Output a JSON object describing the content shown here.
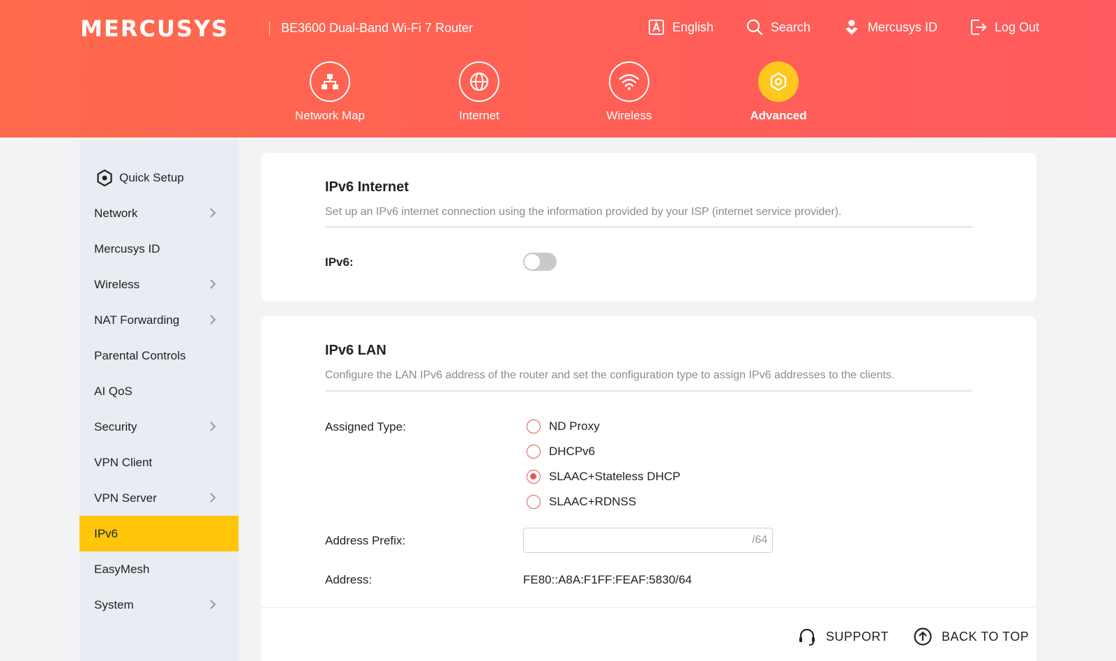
{
  "header": {
    "brand": "MERCUSYS",
    "model": "BE3600 Dual-Band Wi-Fi 7 Router",
    "links": {
      "language": "English",
      "search": "Search",
      "account": "Mercusys ID",
      "logout": "Log Out"
    },
    "nav": [
      {
        "label": "Network Map",
        "icon": "network-map-icon"
      },
      {
        "label": "Internet",
        "icon": "globe-icon"
      },
      {
        "label": "Wireless",
        "icon": "wifi-icon"
      },
      {
        "label": "Advanced",
        "icon": "gear-icon",
        "active": true
      }
    ],
    "colors": {
      "accent": "#ff6055",
      "active": "#ffc81f"
    }
  },
  "sidebar": {
    "items": [
      {
        "label": "Quick Setup",
        "icon": "quick-setup-icon"
      },
      {
        "label": "Network",
        "expandable": true
      },
      {
        "label": "Mercusys ID"
      },
      {
        "label": "Wireless",
        "expandable": true
      },
      {
        "label": "NAT Forwarding",
        "expandable": true
      },
      {
        "label": "Parental Controls"
      },
      {
        "label": "AI QoS"
      },
      {
        "label": "Security",
        "expandable": true
      },
      {
        "label": "VPN Client"
      },
      {
        "label": "VPN Server",
        "expandable": true
      },
      {
        "label": "IPv6",
        "active": true
      },
      {
        "label": "EasyMesh"
      },
      {
        "label": "System",
        "expandable": true
      }
    ]
  },
  "ipv6_internet": {
    "title": "IPv6 Internet",
    "description": "Set up an IPv6 internet connection using the information provided by your ISP (internet service provider).",
    "toggle_label": "IPv6:",
    "enabled": false
  },
  "ipv6_lan": {
    "title": "IPv6 LAN",
    "description": "Configure the LAN IPv6 address of the router and set the configuration type to assign IPv6 addresses to the clients.",
    "assigned_type_label": "Assigned Type:",
    "options": [
      "ND Proxy",
      "DHCPv6",
      "SLAAC+Stateless DHCP",
      "SLAAC+RDNSS"
    ],
    "selected": "SLAAC+Stateless DHCP",
    "prefix_label": "Address Prefix:",
    "prefix_value": "",
    "prefix_suffix": "/64",
    "address_label": "Address:",
    "address_value": "FE80::A8A:F1FF:FEAF:5830/64"
  },
  "footer": {
    "support": "SUPPORT",
    "back_to_top": "BACK TO TOP"
  }
}
